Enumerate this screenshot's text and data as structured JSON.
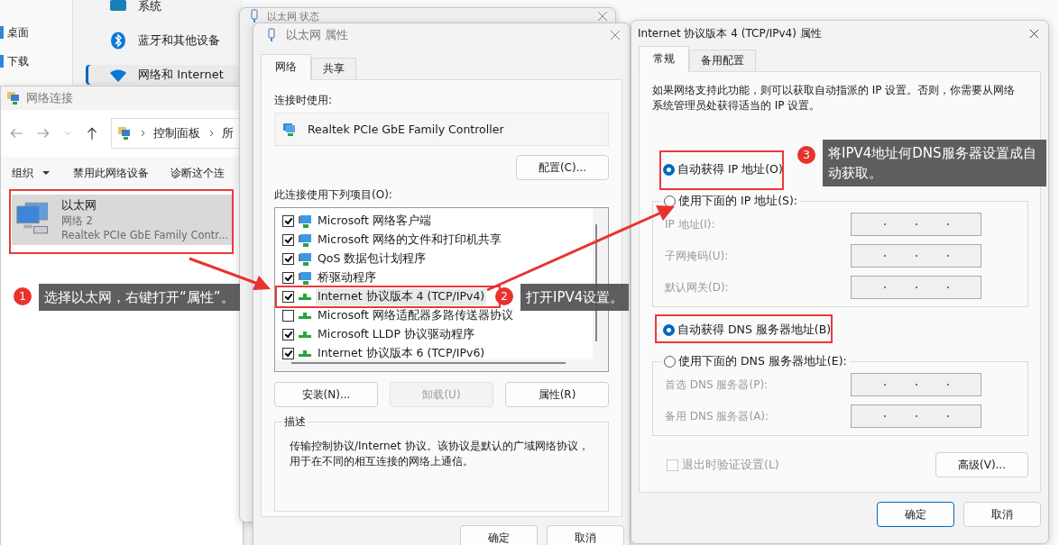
{
  "settings_window": {
    "nav": [
      {
        "label": "桌面"
      },
      {
        "label": "下载"
      }
    ],
    "items": [
      {
        "label": "系统",
        "selected": false
      },
      {
        "label": "蓝牙和其他设备",
        "selected": false
      },
      {
        "label": "网络和 Internet",
        "selected": true
      }
    ]
  },
  "connections_window": {
    "title": "网络连接",
    "breadcrumb": [
      "控制面板",
      "所"
    ],
    "toolbar": [
      "组织",
      "禁用此网络设备",
      "诊断这个连"
    ],
    "adapter": {
      "name": "以太网",
      "network": "网络 2",
      "device": "Realtek PCIe GbE Family Contr...",
      "selected": true
    }
  },
  "status_window": {
    "title": "以太网 状态"
  },
  "properties_window": {
    "title": "以太网 属性",
    "tabs": [
      {
        "label": "网络",
        "selected": true
      },
      {
        "label": "共享",
        "selected": false
      }
    ],
    "connect_using_label": "连接时使用:",
    "adapter": "Realtek PCIe GbE Family Controller",
    "configure_button": "配置(C)...",
    "items_label": "此连接使用下列项目(O):",
    "items": [
      {
        "label": "Microsoft 网络客户端",
        "kind": "client",
        "checked": true,
        "selected": false
      },
      {
        "label": "Microsoft 网络的文件和打印机共享",
        "kind": "service",
        "checked": true,
        "selected": false
      },
      {
        "label": "QoS 数据包计划程序",
        "kind": "service",
        "checked": true,
        "selected": false
      },
      {
        "label": "桥驱动程序",
        "kind": "service",
        "checked": true,
        "selected": false
      },
      {
        "label": "Internet 协议版本 4 (TCP/IPv4)",
        "kind": "protocol",
        "checked": true,
        "selected": true
      },
      {
        "label": "Microsoft 网络适配器多路传送器协议",
        "kind": "protocol",
        "checked": false,
        "selected": false
      },
      {
        "label": "Microsoft LLDP 协议驱动程序",
        "kind": "protocol",
        "checked": true,
        "selected": false
      },
      {
        "label": "Internet 协议版本 6 (TCP/IPv6)",
        "kind": "protocol",
        "checked": true,
        "selected": false
      }
    ],
    "buttons": [
      {
        "label": "安装(N)...",
        "disabled": false
      },
      {
        "label": "卸载(U)",
        "disabled": true
      },
      {
        "label": "属性(R)",
        "disabled": false
      }
    ],
    "description_title": "描述",
    "description": "传输控制协议/Internet 协议。该协议是默认的广域网络协议，用于在不同的相互连接的网络上通信。",
    "footer": [
      "确定",
      "取消"
    ]
  },
  "ipv4_window": {
    "title": "Internet 协议版本 4 (TCP/IPv4) 属性",
    "tabs": [
      {
        "label": "常规",
        "selected": true
      },
      {
        "label": "备用配置",
        "selected": false
      }
    ],
    "intro": "如果网络支持此功能，则可以获取自动指派的 IP 设置。否则，你需要从网络系统管理员处获得适当的 IP 设置。",
    "ip_modes": [
      {
        "label": "自动获得 IP 地址(O)",
        "selected": true
      },
      {
        "label": "使用下面的 IP 地址(S):",
        "selected": false
      }
    ],
    "ip_fields": [
      {
        "label": "IP 地址(I):",
        "disabled": true
      },
      {
        "label": "子网掩码(U):",
        "disabled": true
      },
      {
        "label": "默认网关(D):",
        "disabled": true
      }
    ],
    "dns_modes": [
      {
        "label": "自动获得 DNS 服务器地址(B)",
        "selected": true
      },
      {
        "label": "使用下面的 DNS 服务器地址(E):",
        "selected": false
      }
    ],
    "dns_fields": [
      {
        "label": "首选 DNS 服务器(P):",
        "disabled": true
      },
      {
        "label": "备用 DNS 服务器(A):",
        "disabled": true
      }
    ],
    "validate": {
      "label": "退出时验证设置(L)",
      "checked": false,
      "disabled": true
    },
    "advanced_button": "高级(V)...",
    "footer": [
      "确定",
      "取消"
    ]
  },
  "annotations": [
    {
      "number": "1",
      "text": "选择以太网，右键打开“属性”。"
    },
    {
      "number": "2",
      "text": "打开IPV4设置。"
    },
    {
      "number": "3",
      "text": "将IPV4地址何DNS服务器设置成自动获取。"
    }
  ]
}
